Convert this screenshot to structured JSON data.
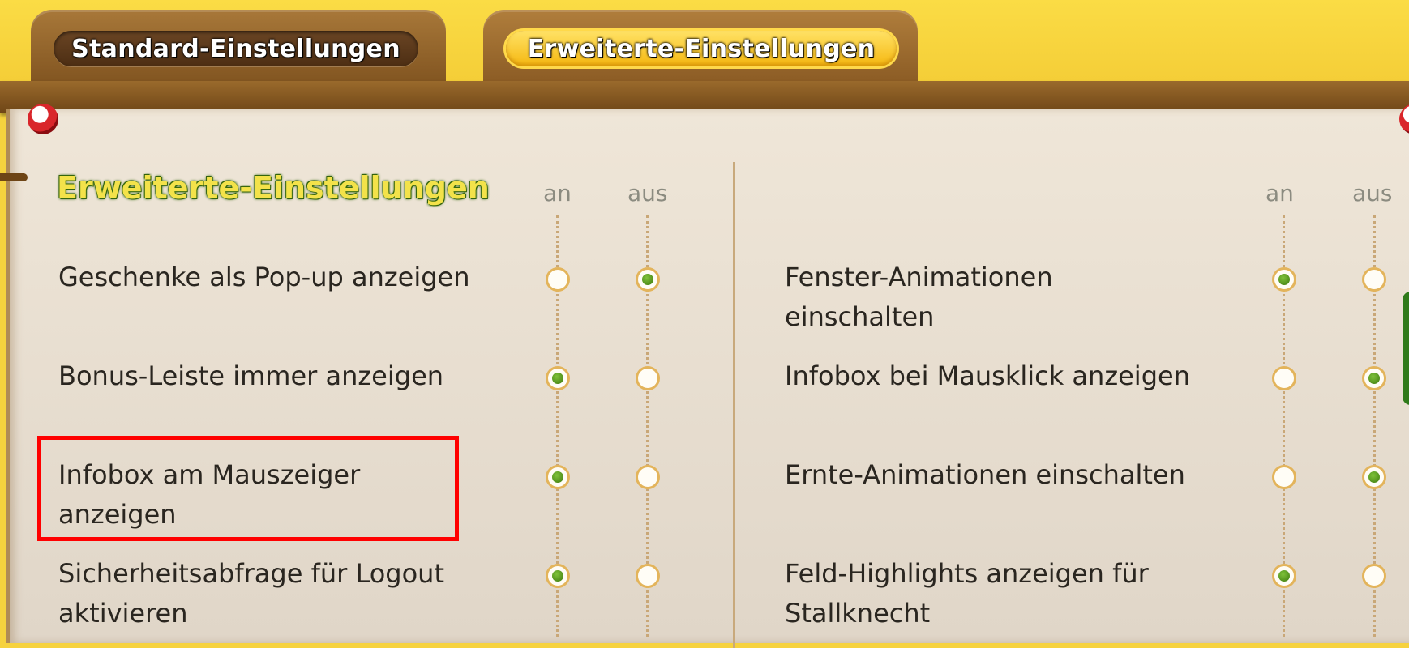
{
  "tabs": {
    "standard_label": "Standard-Einstellungen",
    "extended_label": "Erweiterte-Einstellungen",
    "active": "extended"
  },
  "section": {
    "title": "Erweiterte-Einstellungen",
    "col_on": "an",
    "col_off": "aus"
  },
  "left_settings": [
    {
      "label": "Geschenke als Pop-up anzeigen",
      "value": "aus"
    },
    {
      "label": "Bonus-Leiste immer anzeigen",
      "value": "an"
    },
    {
      "label": "Infobox am Mauszeiger anzeigen",
      "value": "an"
    },
    {
      "label": "Sicherheitsabfrage für Logout aktivieren",
      "value": "an"
    }
  ],
  "right_settings": [
    {
      "label": "Fenster-Animationen einschalten",
      "value": "an"
    },
    {
      "label": "Infobox bei Mausklick anzeigen",
      "value": "aus"
    },
    {
      "label": "Ernte-Animationen einschalten",
      "value": "aus"
    },
    {
      "label": "Feld-Highlights anzeigen für Stallknecht",
      "value": "an"
    }
  ],
  "colors": {
    "accent_yellow": "#f6d23e",
    "wood": "#7a4e1c",
    "radio_selected": "#4f8f16",
    "highlight": "#ff0000"
  }
}
